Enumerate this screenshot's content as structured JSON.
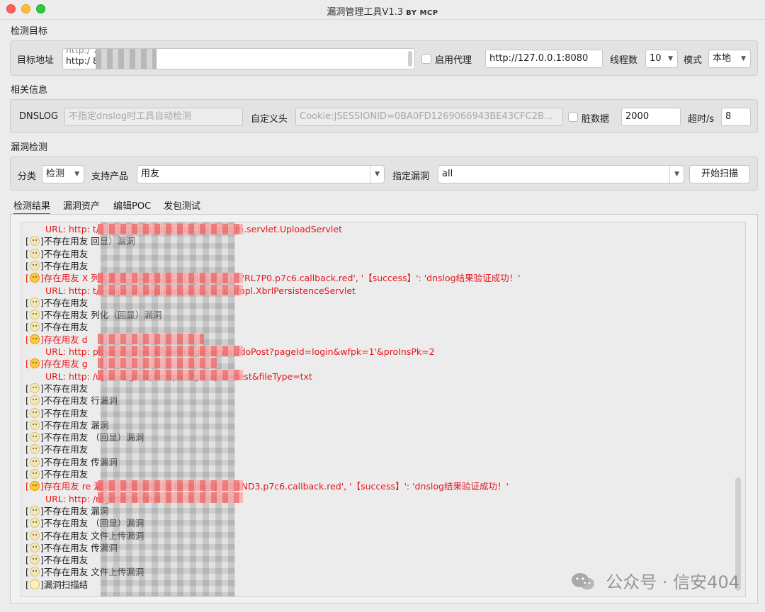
{
  "window": {
    "title": "漏洞管理工具V1.3",
    "title_by": "BY MCP"
  },
  "target_section": {
    "label": "检测目标",
    "target_label": "目标地址",
    "target_lines": [
      "http:/          7:9081",
      "http:/          8090"
    ],
    "proxy_label": "启用代理",
    "proxy_value": "http://127.0.0.1:8080",
    "threads_label": "线程数",
    "threads_value": "10",
    "mode_label": "模式",
    "mode_value": "本地"
  },
  "info_section": {
    "label": "相关信息",
    "dnslog_label": "DNSLOG",
    "dnslog_placeholder": "不指定dnslog时工具自动检测",
    "header_label": "自定义头",
    "header_placeholder": "Cookie:JSESSIONID=0BA0FD1269066943BE43CFC2B...",
    "dirty_label": "脏数据",
    "dirty_value": "2000",
    "timeout_label": "超时/s",
    "timeout_value": "8"
  },
  "scan_section": {
    "label": "漏洞检测",
    "category_label": "分类",
    "category_value": "检测",
    "product_label": "支持产品",
    "product_value": "用友",
    "vuln_label": "指定漏洞",
    "vuln_value": "all",
    "start_button": "开始扫描"
  },
  "tabs": [
    "检测结果",
    "漏洞资产",
    "编辑POC",
    "发包测试"
  ],
  "log": [
    {
      "kind": "url",
      "text": "URL:  http:                                        t/~ic/nc.document.pub.fileSystem.servlet.UploadServlet"
    },
    {
      "kind": "ok",
      "text": "]不存在用友                                       回显）漏洞"
    },
    {
      "kind": "ok",
      "text": "]不存在用友"
    },
    {
      "kind": "ok",
      "text": "]不存在用友"
    },
    {
      "kind": "vuln",
      "text": "]存在用友 X                                       列化漏洞，详细信息：'{{dnslog}}': 'RL7P0.p7c6.callback.red', '【success】': 'dnslog结果验证成功！'"
    },
    {
      "kind": "url",
      "text": "URL:  http:                                        t/~uapxbrl/uap.xbrl.persistenceImpl.XbrlPersistenceServlet"
    },
    {
      "kind": "ok",
      "text": "]不存在用友"
    },
    {
      "kind": "ok",
      "text": "]不存在用友                                       列化（回显）漏洞"
    },
    {
      "kind": "ok",
      "text": "]不存在用友"
    },
    {
      "kind": "vuln",
      "text": "]存在用友 d"
    },
    {
      "kind": "url",
      "text": "URL:  http:                                        pt/servlet/workflowImageServlet/doPost?pageId=login&wfpk=1'&proInsPk=2"
    },
    {
      "kind": "vuln",
      "text": "]存在用友 g"
    },
    {
      "kind": "url",
      "text": "URL:  http:                                        /upload/grouptemplet?groupid=test&fileType=txt"
    },
    {
      "kind": "ok",
      "text": "]不存在用友"
    },
    {
      "kind": "ok",
      "text": "]不存在用友                                       行漏洞"
    },
    {
      "kind": "ok",
      "text": "]不存在用友"
    },
    {
      "kind": "ok",
      "text": "]不存在用友                                       漏洞"
    },
    {
      "kind": "ok",
      "text": "]不存在用友                                       （回显）漏洞"
    },
    {
      "kind": "ok",
      "text": "]不存在用友"
    },
    {
      "kind": "ok",
      "text": "]不存在用友                                       传漏洞"
    },
    {
      "kind": "ok",
      "text": "]不存在用友"
    },
    {
      "kind": "vuln",
      "text": "]存在用友 re                                      漏洞，详细信息：'{{dnslog}}': 'Z3ND3.p7c6.callback.red', '【success】': 'dnslog结果验证成功！'"
    },
    {
      "kind": "url",
      "text": "URL:  http:                                        /registerServlet"
    },
    {
      "kind": "ok",
      "text": "]不存在用友                                       漏洞"
    },
    {
      "kind": "ok",
      "text": "]不存在用友                                       （回显）漏洞"
    },
    {
      "kind": "ok",
      "text": "]不存在用友                                       文件上传漏洞"
    },
    {
      "kind": "ok",
      "text": "]不存在用友                                       传漏洞"
    },
    {
      "kind": "ok",
      "text": "]不存在用友"
    },
    {
      "kind": "ok",
      "text": "]不存在用友                                       文件上传漏洞"
    },
    {
      "kind": "done",
      "text": "]漏洞扫描结"
    }
  ],
  "watermark": "公众号 · 信安404",
  "colors": {
    "vuln": "#e8151c",
    "accent": "#2c6fd6"
  }
}
